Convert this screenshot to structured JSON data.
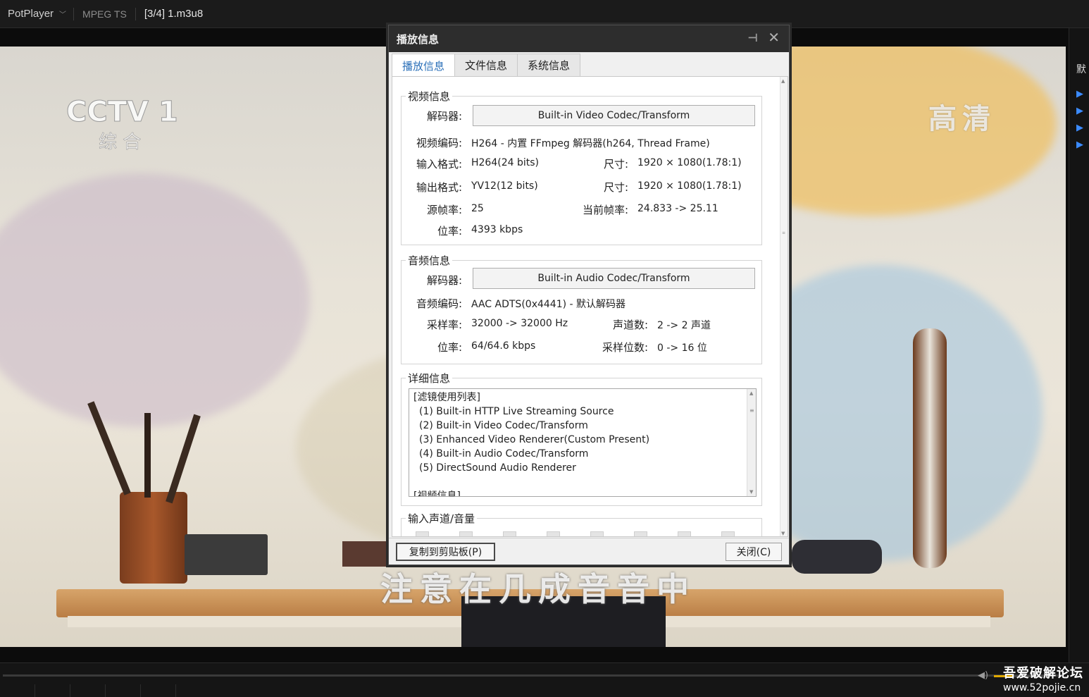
{
  "titlebar": {
    "app_name": "PotPlayer",
    "format": "MPEG TS",
    "file": "[3/4] 1.m3u8"
  },
  "video": {
    "channel_logo": "CCTV 1",
    "channel_sub": "综 合",
    "hd_badge": "高清",
    "subtitle": "注意在几成音音中"
  },
  "right_panel": {
    "label": "默"
  },
  "dialog": {
    "title": "播放信息",
    "tabs": [
      {
        "label": "播放信息",
        "active": true
      },
      {
        "label": "文件信息",
        "active": false
      },
      {
        "label": "系统信息",
        "active": false
      }
    ],
    "video_info": {
      "title": "视频信息",
      "decoder_label": "解码器:",
      "decoder_value": "Built-in Video Codec/Transform",
      "codec_label": "视频编码:",
      "codec_value": "H264 - 内置 FFmpeg 解码器(h264, Thread Frame)",
      "input_format_label": "输入格式:",
      "input_format_value": "H264(24 bits)",
      "input_size_label": "尺寸:",
      "input_size_value": "1920 × 1080(1.78:1)",
      "output_format_label": "输出格式:",
      "output_format_value": "YV12(12 bits)",
      "output_size_label": "尺寸:",
      "output_size_value": "1920 × 1080(1.78:1)",
      "source_fps_label": "源帧率:",
      "source_fps_value": "25",
      "current_fps_label": "当前帧率:",
      "current_fps_value": "24.833 -> 25.11",
      "bitrate_label": "位率:",
      "bitrate_value": "4393 kbps"
    },
    "audio_info": {
      "title": "音频信息",
      "decoder_label": "解码器:",
      "decoder_value": "Built-in Audio Codec/Transform",
      "codec_label": "音频编码:",
      "codec_value": "AAC ADTS(0x4441) - 默认解码器",
      "samplerate_label": "采样率:",
      "samplerate_value": "32000 -> 32000 Hz",
      "channels_label": "声道数:",
      "channels_value": "2 -> 2 声道",
      "bitrate_label": "位率:",
      "bitrate_value": "64/64.6 kbps",
      "bitdepth_label": "采样位数:",
      "bitdepth_value": "0 -> 16 位"
    },
    "detail_info": {
      "title": "详细信息",
      "lines": [
        "[滤镜使用列表]",
        "  (1) Built-in HTTP Live Streaming Source",
        "  (2) Built-in Video Codec/Transform",
        "  (3) Enhanced Video Renderer(Custom Present)",
        "  (4) Built-in Audio Codec/Transform",
        "  (5) DirectSound Audio Renderer",
        "",
        "[视频信息]"
      ]
    },
    "channel_volume": {
      "title": "输入声道/音量"
    },
    "copy_button": "复制到剪贴板(P)",
    "close_button": "关闭(C)"
  },
  "watermark": {
    "line1": "吾爱破解论坛",
    "line2": "www.52pojie.cn"
  },
  "player": {
    "volume_level": 0.35
  },
  "colors": {
    "accent": "#2a6fb8",
    "play_marker": "#3b8bff",
    "volume": "#e0a800"
  }
}
